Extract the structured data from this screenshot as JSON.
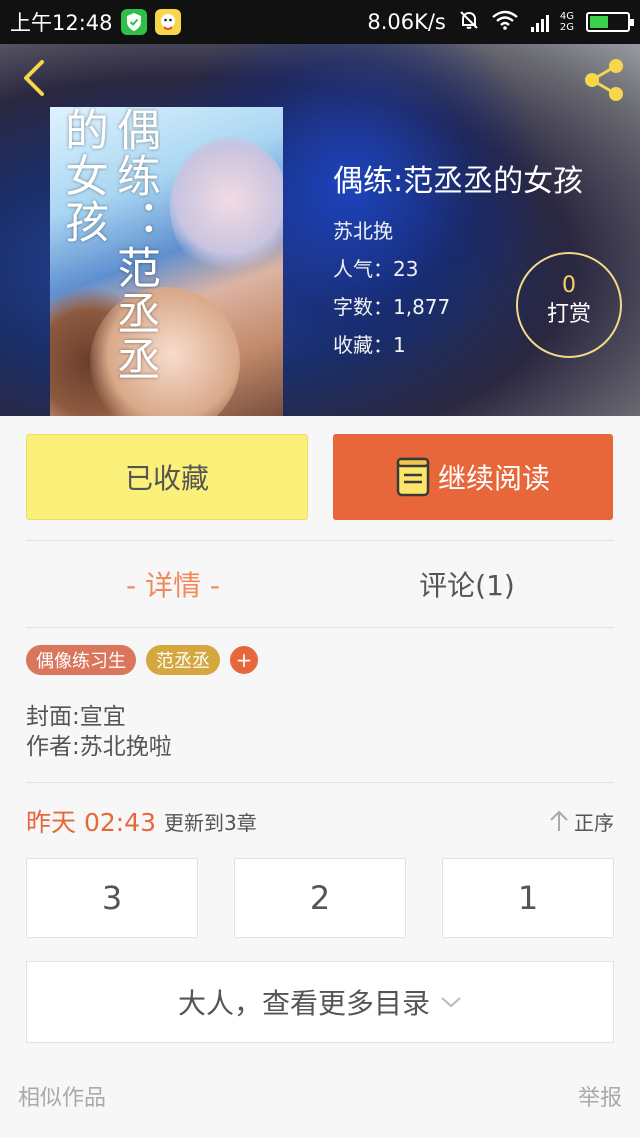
{
  "status_bar": {
    "time": "上午12:48",
    "speed": "8.06K/s",
    "network_4g": "4G",
    "network_2g": "2G"
  },
  "book": {
    "cover_title": "偶练：范丞丞的女孩",
    "title": "偶练:范丞丞的女孩",
    "author": "苏北挽",
    "popularity": "人气：23",
    "word_count": "字数：1,877",
    "favorites": "收藏：1"
  },
  "reward": {
    "count": "0",
    "label": "打赏"
  },
  "actions": {
    "collected_label": "已收藏",
    "continue_label": "继续阅读"
  },
  "tabs": [
    {
      "label": "- 详情 -"
    },
    {
      "label": "评论(1)"
    }
  ],
  "tags": [
    {
      "label": "偶像练习生"
    },
    {
      "label": "范丞丞"
    }
  ],
  "tag_add": "+",
  "description": {
    "cover_credit": "封面:宣宜",
    "author_credit": "作者:苏北挽啦"
  },
  "update": {
    "time": "昨天 02:43",
    "text": "更新到3章",
    "sort_label": "正序"
  },
  "chapters": [
    "3",
    "2",
    "1"
  ],
  "more_catalog": "大人，查看更多目录",
  "footer": {
    "similar": "相似作品",
    "report": "举报"
  },
  "colors": {
    "accent": "#e8673a",
    "collected_bg": "#fbf17a",
    "tag1": "#d9765c",
    "tag2": "#d4a73f"
  },
  "icons": [
    "shield-icon",
    "qq-icon",
    "mute-bell-icon",
    "wifi-icon",
    "signal-icon",
    "battery-icon",
    "back-icon",
    "share-icon",
    "book-icon",
    "sort-up-icon",
    "chevron-down-icon"
  ]
}
